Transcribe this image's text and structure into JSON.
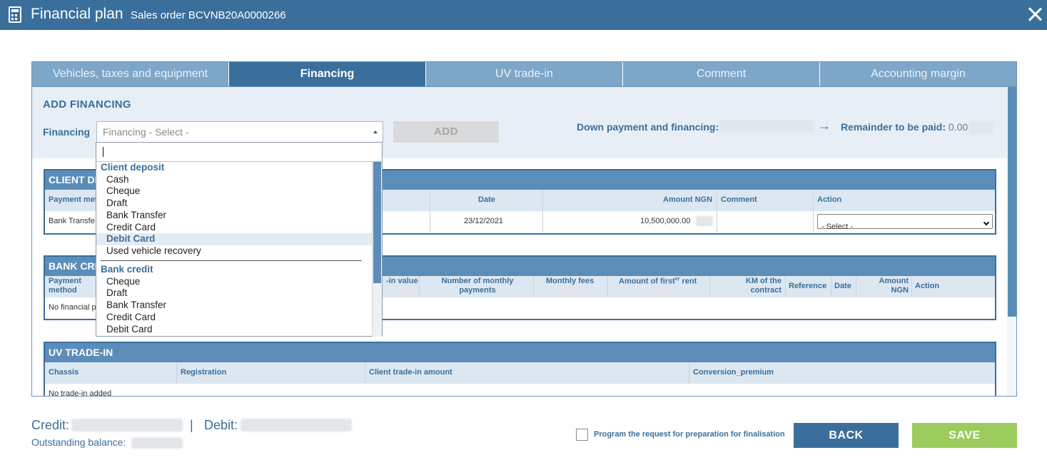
{
  "titlebar": {
    "title": "Financial plan",
    "subtitle": "Sales order BCVNB20A0000266",
    "icon": "calculator-icon",
    "close_icon": "close-icon"
  },
  "tabs": [
    {
      "label": "Vehicles, taxes and equipment",
      "active": false
    },
    {
      "label": "Financing",
      "active": true
    },
    {
      "label": "UV trade-in",
      "active": false
    },
    {
      "label": "Comment",
      "active": false
    },
    {
      "label": "Accounting margin",
      "active": false
    }
  ],
  "add_financing": {
    "heading": "ADD FINANCING",
    "field_label": "Financing",
    "select_value": "Financing - Select -",
    "add_button": "ADD",
    "down_payment_label": "Down payment and financing:",
    "arrow": "→",
    "remainder_label": "Remainder to be paid:",
    "remainder_value": "0.00"
  },
  "dropdown": {
    "groups": [
      {
        "label": "Client deposit",
        "options": [
          "Cash",
          "Cheque",
          "Draft",
          "Bank Transfer",
          "Credit Card",
          "Debit Card",
          "Used vehicle recovery"
        ]
      },
      {
        "label": "Bank credit",
        "options": [
          "Cheque",
          "Draft",
          "Bank Transfer",
          "Credit Card",
          "Debit Card"
        ]
      }
    ],
    "highlighted": "Debit Card"
  },
  "client_deposit": {
    "title_visible": "CLIENT DE",
    "columns": {
      "payment": "Payment met",
      "date": "Date",
      "amount": "Amount NGN",
      "comment": "Comment",
      "action": "Action"
    },
    "row": {
      "payment": "Bank Transfe",
      "date": "23/12/2021",
      "amount": "10,500,000.00",
      "action_select": "- Select -"
    }
  },
  "bank_credit": {
    "title_visible": "BANK CRE",
    "columns": {
      "payment": "Payment method",
      "value_partial": "-in value",
      "monthly_payments": "Number of monthly payments",
      "monthly_fees": "Monthly fees",
      "first_rent_main": "Amount of first",
      "first_rent_sup": "er",
      "first_rent_end": " rent",
      "km": "KM of the contract",
      "reference": "Reference",
      "date": "Date",
      "amount": "Amount NGN",
      "action": "Action"
    },
    "empty_text": "No financial p"
  },
  "uv_tradein": {
    "title": "UV TRADE-IN",
    "columns": {
      "chassis": "Chassis",
      "registration": "Registration",
      "client_amount": "Client trade-in amount",
      "conversion": "Conversion_premium"
    },
    "empty_text": "No trade-in added"
  },
  "footer": {
    "credit_label": "Credit:",
    "divider": "|",
    "debit_label": "Debit:",
    "outstanding_label": "Outstanding balance:",
    "checkbox_label": "Program the request for preparation for finalisation",
    "checkbox_checked": false,
    "back": "BACK",
    "save": "SAVE"
  },
  "colors": {
    "primary": "#3a6f9c",
    "tab_inactive": "#7ea6c8",
    "section_header": "#5b8db8",
    "save_green": "#9acb5c"
  }
}
